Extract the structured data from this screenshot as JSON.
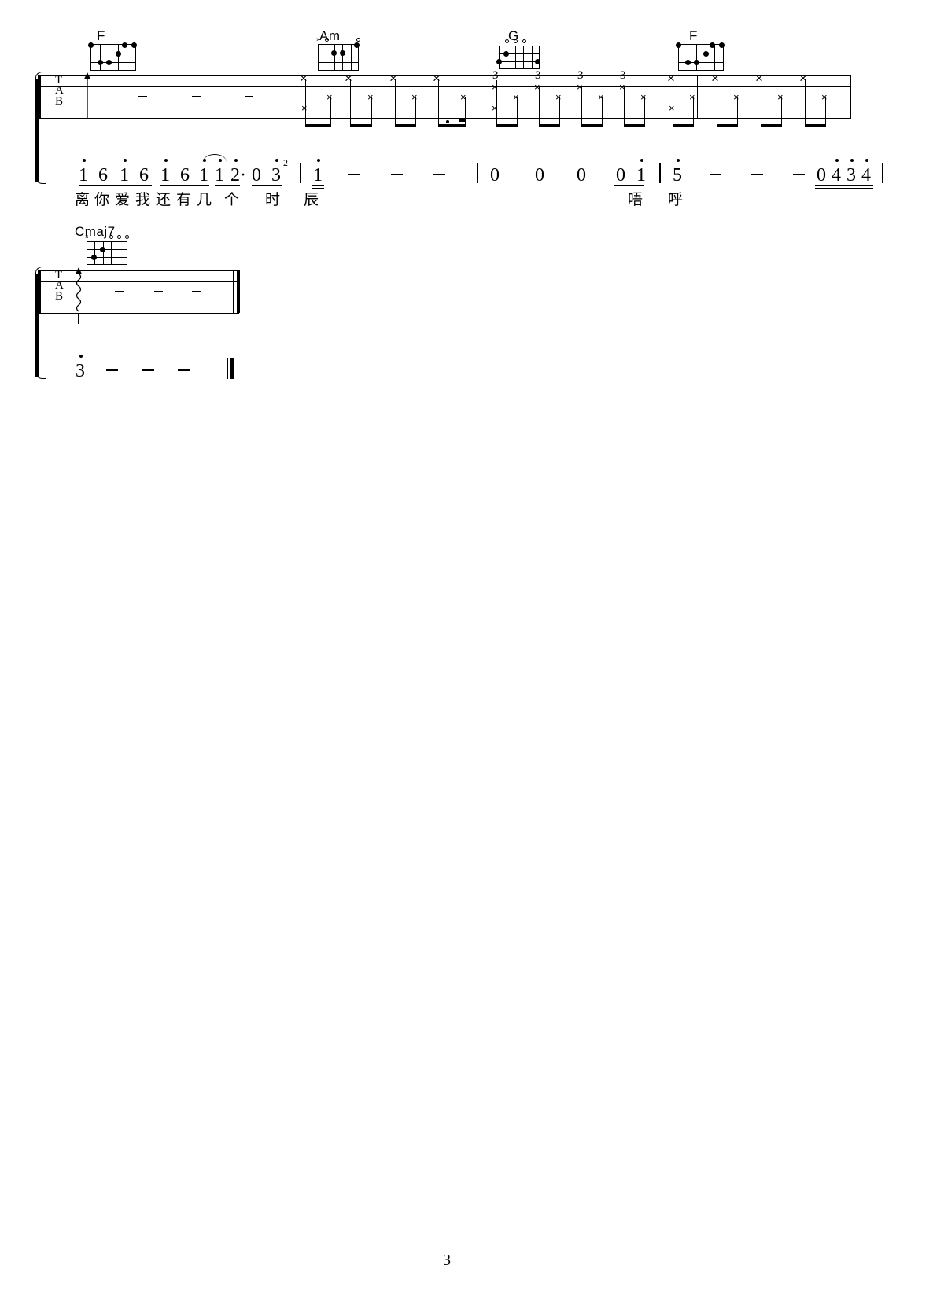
{
  "document": {
    "type": "guitar-tablature-sheet-music",
    "page_number": "3",
    "background_color": "#ffffff",
    "ink_color": "#000000"
  },
  "systems": [
    {
      "id": "system-1",
      "measures": [
        {
          "chord_name": "F",
          "chord_diagram": {
            "name": "F",
            "markers": [
              "",
              "",
              "",
              "",
              "",
              ""
            ],
            "dots": [
              {
                "string": 6,
                "fret": 1
              },
              {
                "string": 5,
                "fret": 3
              },
              {
                "string": 4,
                "fret": 3
              },
              {
                "string": 3,
                "fret": 2
              },
              {
                "string": 2,
                "fret": 1
              },
              {
                "string": 1,
                "fret": 1
              }
            ]
          },
          "tab_content": "arpeggio-arrow-and-rests",
          "rest_dashes": 3
        },
        {
          "chord_name": "Am",
          "chord_diagram": {
            "name": "Am",
            "markers": [
              "x",
              "o",
              "",
              "",
              "",
              "o"
            ],
            "dots": [
              {
                "string": 4,
                "fret": 2
              },
              {
                "string": 3,
                "fret": 2
              },
              {
                "string": 2,
                "fret": 1
              }
            ]
          },
          "tab_content": "strum-x-pattern",
          "strum_count": 6
        },
        {
          "chord_name": "G",
          "chord_diagram": {
            "name": "G",
            "markers": [
              "",
              "o",
              "o",
              "o",
              "",
              ""
            ],
            "dots": [
              {
                "string": 6,
                "fret": 3
              },
              {
                "string": 5,
                "fret": 2
              },
              {
                "string": 1,
                "fret": 3
              }
            ]
          },
          "tab_content": "strum-x-pattern-fret3",
          "fret_labels": [
            "3",
            "3",
            "3",
            "3"
          ],
          "strum_count": 8
        },
        {
          "chord_name": "F",
          "chord_diagram": {
            "name": "F",
            "markers": [
              "",
              "",
              "",
              "",
              "",
              ""
            ],
            "dots": [
              {
                "string": 6,
                "fret": 1
              },
              {
                "string": 5,
                "fret": 3
              },
              {
                "string": 4,
                "fret": 3
              },
              {
                "string": 3,
                "fret": 2
              },
              {
                "string": 2,
                "fret": 1
              },
              {
                "string": 1,
                "fret": 1
              }
            ]
          },
          "tab_content": "strum-x-pattern",
          "strum_count": 8
        }
      ],
      "tab_letters": [
        "T",
        "A",
        "B"
      ],
      "jianpu": {
        "measures": [
          {
            "notes": [
              "1",
              "6",
              "1",
              "6",
              "1",
              "6",
              "1",
              "1",
              "2·",
              "0",
              "3"
            ],
            "octave_high": [
              true,
              false,
              true,
              false,
              true,
              false,
              true,
              true,
              true,
              false,
              false
            ],
            "superscript": "2"
          },
          {
            "notes": [
              "1",
              "—",
              "—",
              "—"
            ],
            "octave_high": [
              true,
              false,
              false,
              false
            ]
          },
          {
            "notes": [
              "0",
              "0",
              "0",
              "0",
              "1"
            ],
            "octave_high": [
              false,
              false,
              false,
              false,
              true
            ]
          },
          {
            "notes": [
              "5",
              "—",
              "—",
              "0",
              "4",
              "3",
              "4"
            ],
            "octave_high": [
              true,
              false,
              false,
              false,
              true,
              true,
              true
            ]
          }
        ]
      },
      "lyrics_line_1": [
        "离",
        "你",
        "爱",
        "我",
        "还",
        "有",
        "几",
        "个",
        "时",
        "辰"
      ],
      "lyrics_line_2": [
        "唔",
        "呼"
      ]
    },
    {
      "id": "system-2",
      "measures": [
        {
          "chord_name": "Cmaj7",
          "chord_diagram": {
            "name": "Cmaj7",
            "markers": [
              "x",
              "",
              "",
              "o",
              "o",
              "o"
            ],
            "dots": [
              {
                "string": 5,
                "fret": 3
              },
              {
                "string": 4,
                "fret": 2
              }
            ]
          },
          "tab_content": "arpeggio-wavy-arrow-and-rests",
          "rest_dashes": 3
        }
      ],
      "tab_letters": [
        "T",
        "A",
        "B"
      ],
      "jianpu": {
        "measures": [
          {
            "notes": [
              "3",
              "—",
              "—",
              "—"
            ],
            "octave_high": [
              true,
              false,
              false,
              false
            ]
          }
        ]
      },
      "ending": "final-double-barline"
    }
  ],
  "footer": {
    "page_number": "3"
  }
}
